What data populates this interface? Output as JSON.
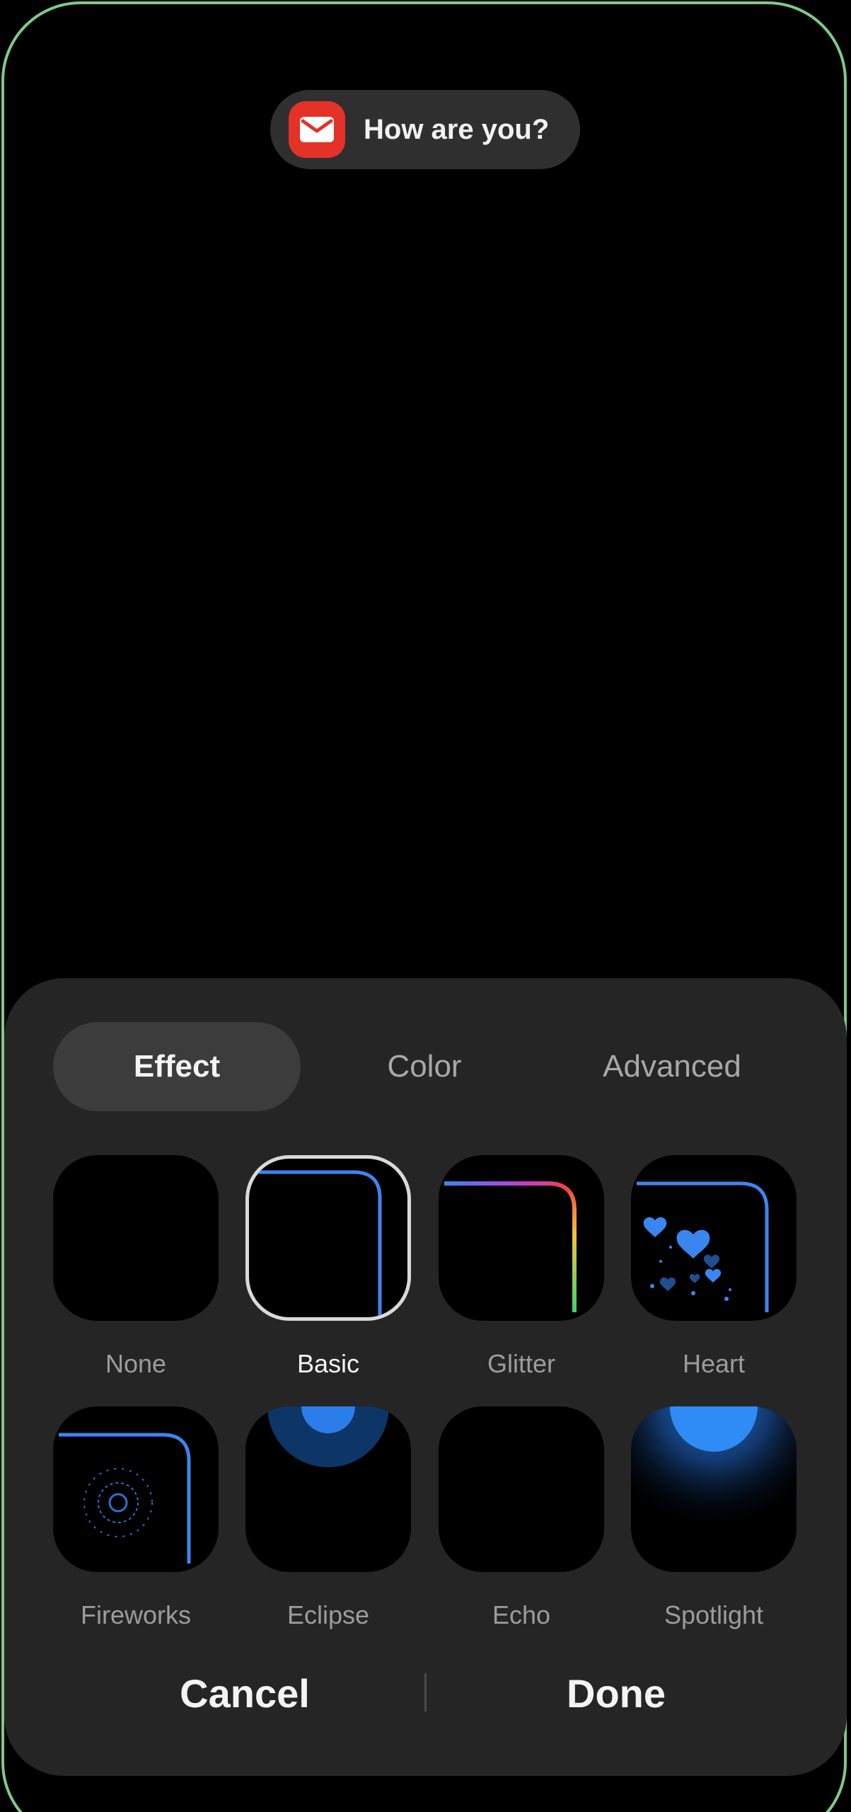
{
  "notification": {
    "icon": "mail-icon",
    "text": "How are you?",
    "icon_color": "#e53228"
  },
  "tabs": [
    {
      "label": "Effect",
      "active": true
    },
    {
      "label": "Color",
      "active": false
    },
    {
      "label": "Advanced",
      "active": false
    }
  ],
  "effects": [
    {
      "label": "None",
      "selected": false
    },
    {
      "label": "Basic",
      "selected": true
    },
    {
      "label": "Glitter",
      "selected": false
    },
    {
      "label": "Heart",
      "selected": false
    },
    {
      "label": "Fireworks",
      "selected": false
    },
    {
      "label": "Eclipse",
      "selected": false
    },
    {
      "label": "Echo",
      "selected": false
    },
    {
      "label": "Spotlight",
      "selected": false
    }
  ],
  "actions": {
    "cancel_label": "Cancel",
    "done_label": "Done"
  },
  "colors": {
    "accent_blue": "#3a86f0",
    "sheet_bg": "#252525",
    "edge_outline": "#7fc98a"
  }
}
